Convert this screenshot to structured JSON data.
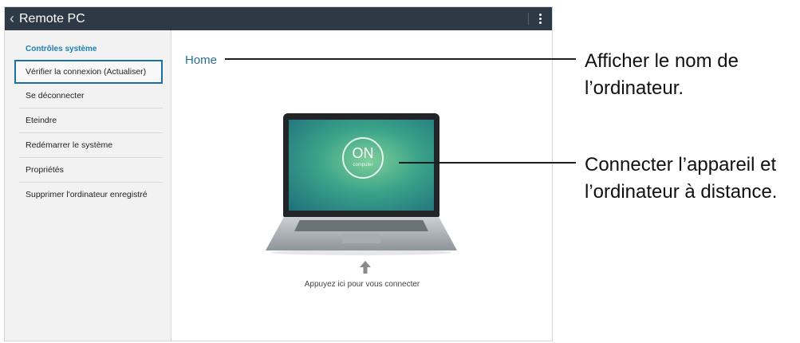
{
  "actionbar": {
    "title": "Remote PC",
    "back_icon": "chevron-left-icon",
    "menu_icon": "overflow-menu-icon"
  },
  "sidebar": {
    "section_title": "Contrôles système",
    "items": [
      {
        "label": "Vérifier la connexion (Actualiser)",
        "selected": true
      },
      {
        "label": "Se déconnecter"
      },
      {
        "label": "Eteindre"
      },
      {
        "label": "Redémarrer le système"
      },
      {
        "label": "Propriétés"
      },
      {
        "label": "Supprimer l'ordinateur enregistré"
      }
    ]
  },
  "main": {
    "home_label": "Home",
    "screen_on": "ON",
    "screen_sub": "computer",
    "hint": "Appuyez ici pour vous connecter"
  },
  "callouts": {
    "home_line1": "Afficher le nom de",
    "home_line2": "l’ordinateur.",
    "connect_line1": "Connecter l’appareil et",
    "connect_line2": "l’ordinateur à distance."
  },
  "colors": {
    "actionbar_bg": "#2d3a46",
    "accent": "#1f7fb3",
    "selection_border": "#1a6fa8"
  }
}
